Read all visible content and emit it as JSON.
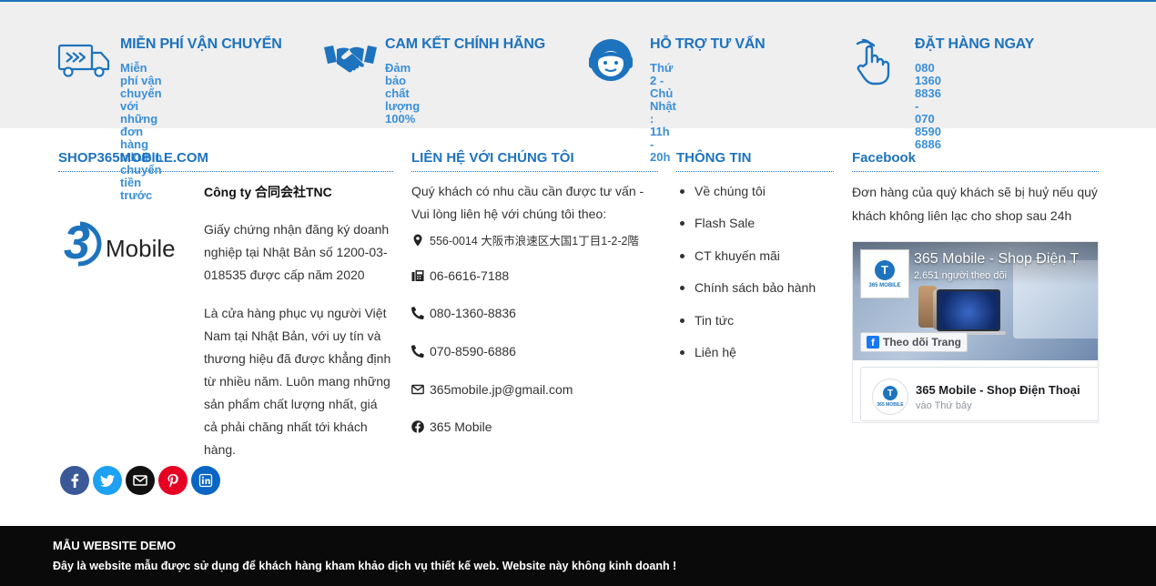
{
  "colors": {
    "accent": "#1e73be",
    "feature_desc": "#3a8fd8",
    "band_bg": "#efefef",
    "bottom_bg": "#0a0a0a",
    "facebook": "#3b5998",
    "twitter": "#1da1f2",
    "email": "#111111",
    "pinterest": "#e60023",
    "linkedin": "#0a66c2"
  },
  "features": [
    {
      "icon": "delivery-truck-icon",
      "title": "MIỄN PHÍ VẬN CHUYỂN",
      "desc_lines": [
        "Miễn phí vận chuyển với những",
        "đơn hàng takubin chuyển tiền",
        "trước"
      ]
    },
    {
      "icon": "handshake-icon",
      "title": "CAM KẾT CHÍNH HÃNG",
      "desc_lines": [
        "Đảm bảo chất lượng 100%"
      ]
    },
    {
      "icon": "support-agent-icon",
      "title": "HỖ TRỢ TƯ VẤN",
      "desc_lines": [
        "Thứ 2 - Chủ Nhật : 11h - 20h"
      ]
    },
    {
      "icon": "hand-pointer-icon",
      "title": "ĐẶT HÀNG NGAY",
      "desc_lines": [
        "080 1360 8836 - 070 8590 6886"
      ]
    }
  ],
  "company": {
    "title": "SHOP365MOBILE.COM",
    "logo_text": "Mobile",
    "name_prefix": "Công ty ",
    "name_jp": "合同会社TNC",
    "p1": "Giấy chứng nhận đăng ký doanh nghiệp tại Nhật Bản số 1200-03-018535 được cấp năm 2020",
    "p2": "Là cửa hàng phục vụ người Việt Nam tại Nhật Bản, với uy tín và thương hiệu đã được khẳng định từ nhiều năm. Luôn mang những sản phẩm chất lượng nhất, giá cả phải chăng nhất tới khách hàng."
  },
  "socials": [
    {
      "icon": "facebook-icon",
      "color": "#3b5998"
    },
    {
      "icon": "twitter-icon",
      "color": "#1da1f2"
    },
    {
      "icon": "envelope-icon",
      "color": "#111111"
    },
    {
      "icon": "pinterest-icon",
      "color": "#e60023"
    },
    {
      "icon": "linkedin-icon",
      "color": "#0a66c2"
    }
  ],
  "contact": {
    "title": "LIÊN HỆ VỚI CHÚNG TÔI",
    "intro": "Quý khách có nhu cầu cần được tư vấn - Vui lòng liên hệ với chúng tôi theo:",
    "address": "556-0014 大阪市浪速区大国1丁目1-2-2階",
    "fax": "06-6616-7188",
    "phone1": "080-1360-8836",
    "phone2": "070-8590-6886",
    "email": "365mobile.jp@gmail.com",
    "facebook": "365 Mobile"
  },
  "info": {
    "title": "THÔNG TIN",
    "items": [
      "Về chúng tôi",
      "Flash Sale",
      "CT khuyến mãi",
      "Chính sách bảo hành",
      "Tin tức",
      "Liên hệ"
    ]
  },
  "facebook": {
    "title": "Facebook",
    "text": "Đơn hàng của quý khách sẽ bị huỷ nếu quý khách không liên lạc cho shop sau 24h",
    "page_name": "365 Mobile - Shop Điện T",
    "followers": "2.651 người theo dõi",
    "follow_label": "Theo dõi Trang",
    "avatar_letter": "T",
    "avatar_label": "365 MOBILE",
    "post_name": "365 Mobile - Shop Điện Thoại",
    "post_time": "vào Thứ bảy"
  },
  "bottom": {
    "title": "MẪU WEBSITE DEMO",
    "text": "Đây là website mẫu được sử dụng để khách hàng kham khảo dịch vụ thiết kế web. Website này không kinh doanh !"
  }
}
